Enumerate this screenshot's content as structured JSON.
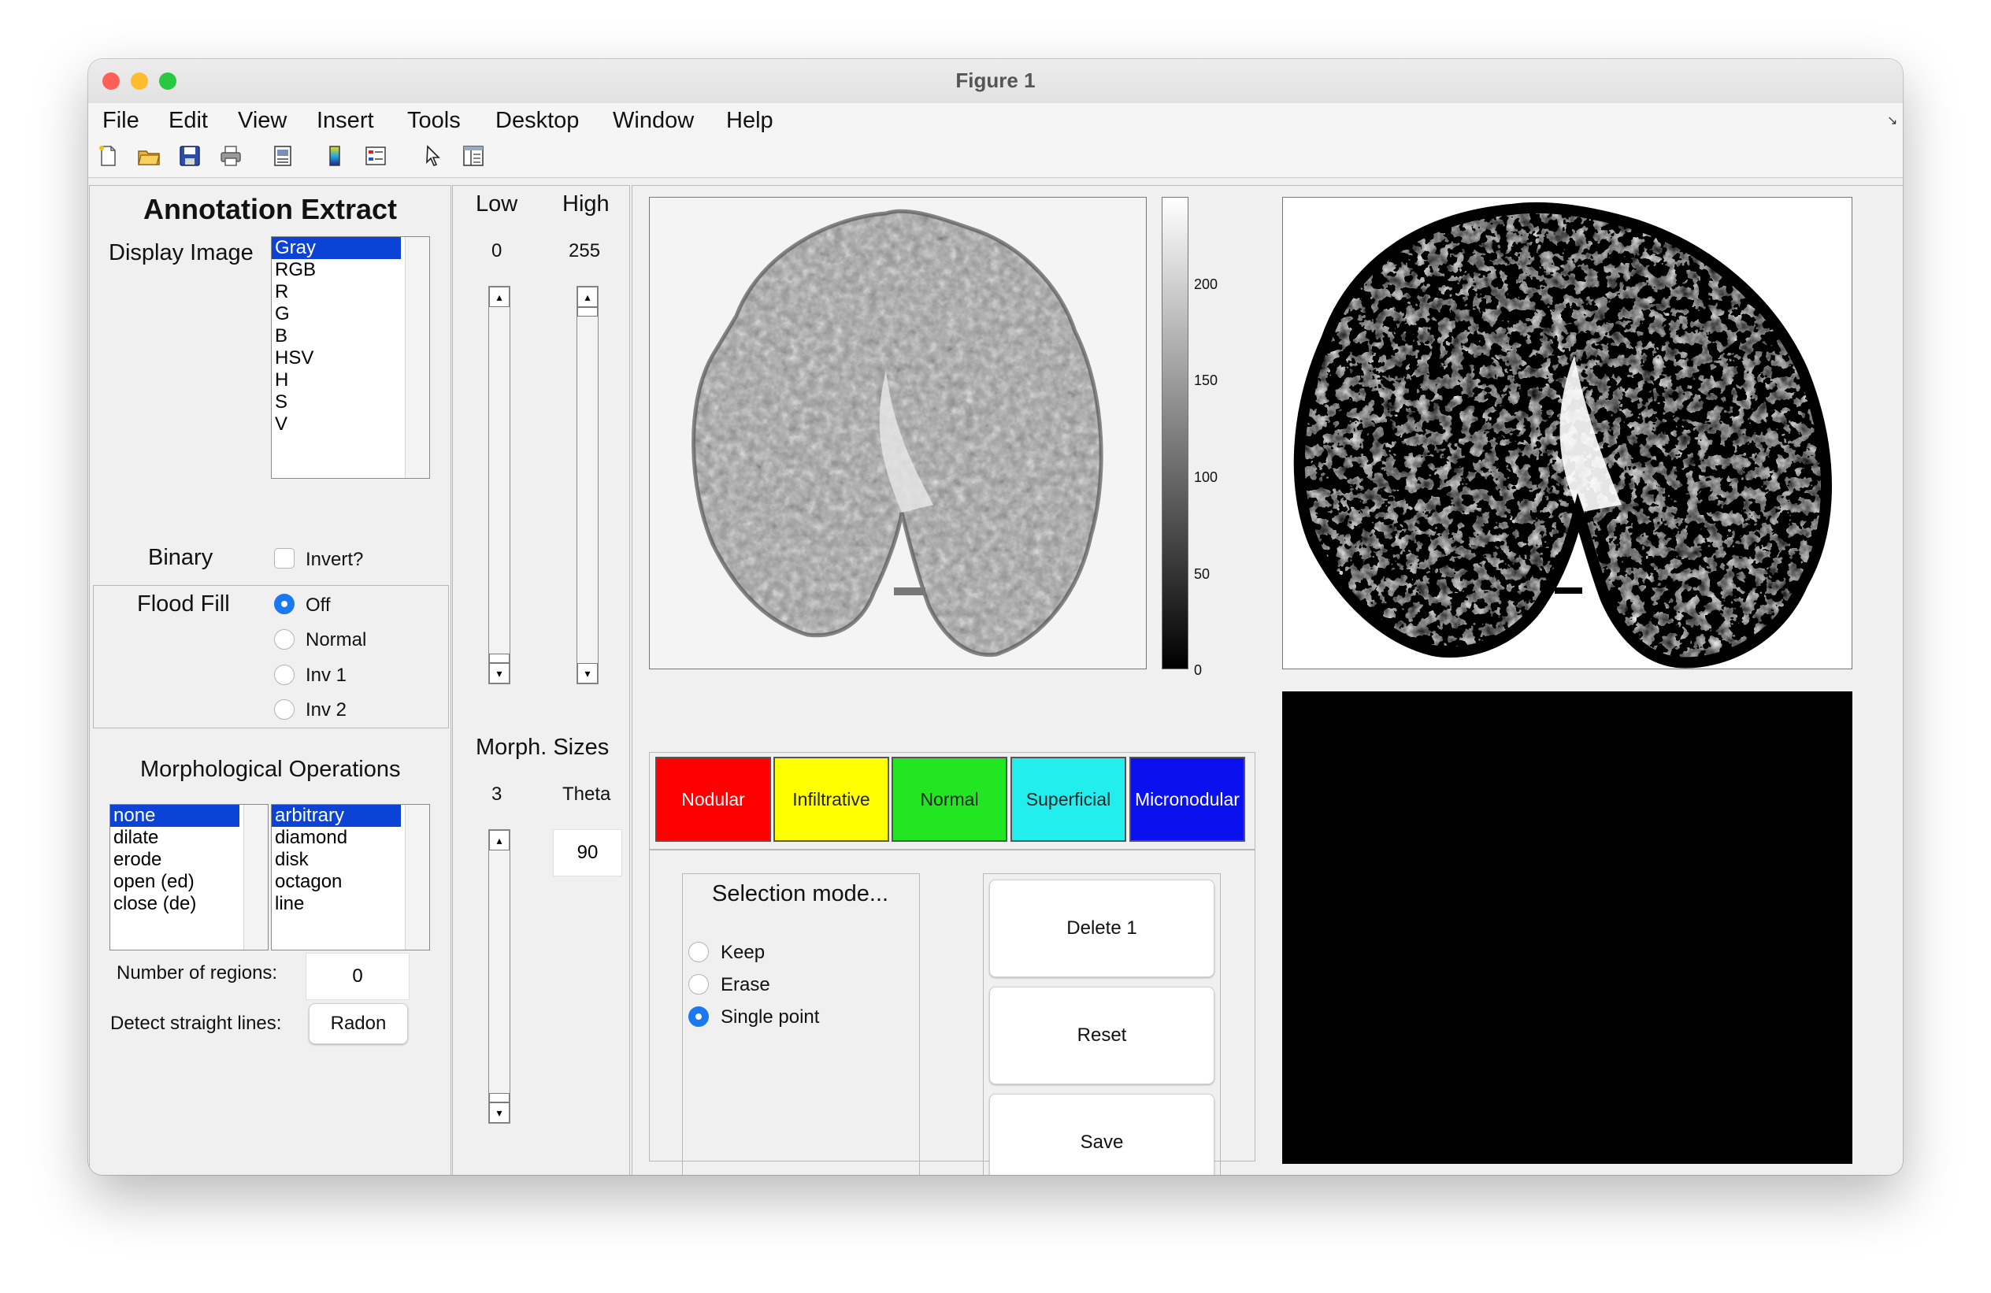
{
  "window": {
    "title": "Figure 1",
    "traffic_colors": [
      "#ff5f57",
      "#febc2e",
      "#28c840"
    ]
  },
  "menubar": {
    "items": [
      "File",
      "Edit",
      "View",
      "Insert",
      "Tools",
      "Desktop",
      "Window",
      "Help"
    ]
  },
  "toolbar": {
    "icons": [
      "new-file-icon",
      "open-folder-icon",
      "save-icon",
      "print-icon",
      "print-preview-icon",
      "colorbar-icon",
      "legend-icon",
      "pointer-icon",
      "property-inspector-icon"
    ]
  },
  "left_panel": {
    "title": "Annotation Extract",
    "display_image_label": "Display Image",
    "display_image_options": [
      "Gray",
      "RGB",
      "R",
      "G",
      "B",
      "HSV",
      "H",
      "S",
      "V"
    ],
    "display_image_selected": "Gray",
    "binary_label": "Binary",
    "invert_label": "Invert?",
    "flood_fill_label": "Flood Fill",
    "flood_fill_options": [
      "Off",
      "Normal",
      "Inv 1",
      "Inv 2"
    ],
    "flood_fill_selected": "Off",
    "morph_title": "Morphological Operations",
    "morph_ops": [
      "none",
      "dilate",
      "erode",
      "open (ed)",
      "close (de)"
    ],
    "morph_ops_selected": "none",
    "morph_shapes": [
      "arbitrary",
      "diamond",
      "disk",
      "octagon",
      "line"
    ],
    "morph_shapes_selected": "arbitrary",
    "num_regions_label": "Number of regions:",
    "num_regions_value": "0",
    "detect_lines_label": "Detect straight lines:",
    "radon_button": "Radon"
  },
  "threshold_panel": {
    "low_label": "Low",
    "high_label": "High",
    "low_value": "0",
    "high_value": "255",
    "low_slider_fraction": 0.0,
    "high_slider_fraction": 1.0,
    "morph_sizes_label": "Morph. Sizes",
    "morph_size_value": "3",
    "theta_label": "Theta",
    "theta_value": "90"
  },
  "colorbar": {
    "ticks": [
      "200",
      "150",
      "100",
      "50",
      "0"
    ],
    "range": [
      0,
      255
    ]
  },
  "classes": [
    {
      "label": "Nodular",
      "color": "#ff0000",
      "text_color": "#ffffff"
    },
    {
      "label": "Infiltrative",
      "color": "#ffff00",
      "text_color": "#222222"
    },
    {
      "label": "Normal",
      "color": "#22e622",
      "text_color": "#222222"
    },
    {
      "label": "Superficial",
      "color": "#22eeee",
      "text_color": "#222222"
    },
    {
      "label": "Micronodular",
      "color": "#0a10ee",
      "text_color": "#ffffff"
    }
  ],
  "selection_mode": {
    "title": "Selection mode...",
    "options": [
      "Keep",
      "Erase",
      "Single point"
    ],
    "selected": "Single point"
  },
  "actions": {
    "delete_label": "Delete 1",
    "reset_label": "Reset",
    "save_label": "Save"
  }
}
